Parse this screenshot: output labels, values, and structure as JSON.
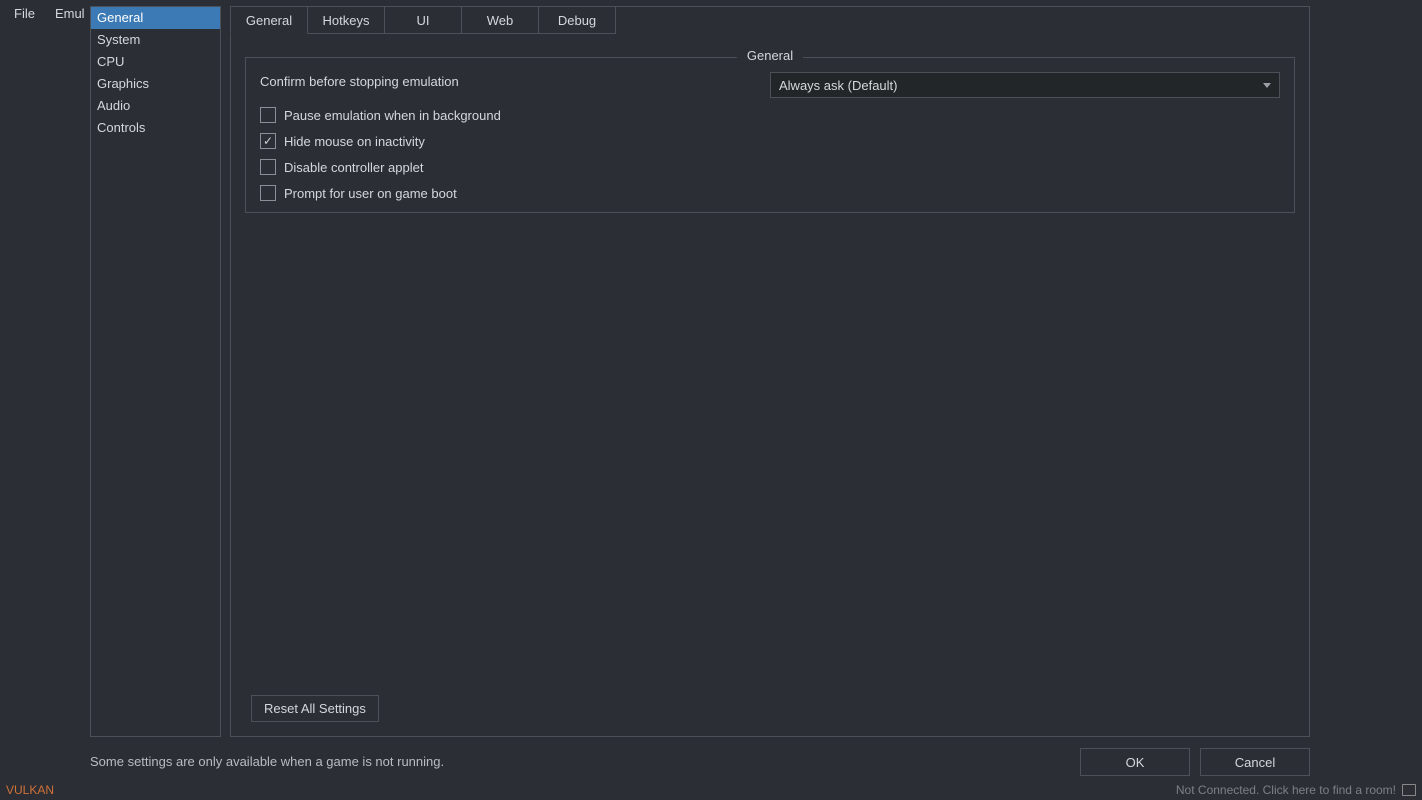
{
  "menubar": {
    "file": "File",
    "emul": "Emul"
  },
  "sidebar": {
    "items": [
      "General",
      "System",
      "CPU",
      "Graphics",
      "Audio",
      "Controls"
    ],
    "selected": 0
  },
  "tabs": {
    "items": [
      "General",
      "Hotkeys",
      "UI",
      "Web",
      "Debug"
    ],
    "active": 0
  },
  "group": {
    "title": "General",
    "confirm_label": "Confirm before stopping emulation",
    "confirm_value": "Always ask (Default)",
    "checks": [
      {
        "label": "Pause emulation when in background",
        "checked": false
      },
      {
        "label": "Hide mouse on inactivity",
        "checked": true
      },
      {
        "label": "Disable controller applet",
        "checked": false
      },
      {
        "label": "Prompt for user on game boot",
        "checked": false
      }
    ]
  },
  "reset_label": "Reset All Settings",
  "footer_note": "Some settings are only available when a game is not running.",
  "ok_label": "OK",
  "cancel_label": "Cancel",
  "statusbar": {
    "vulkan": "VULKAN",
    "right": "Not Connected. Click here to find a room!"
  }
}
